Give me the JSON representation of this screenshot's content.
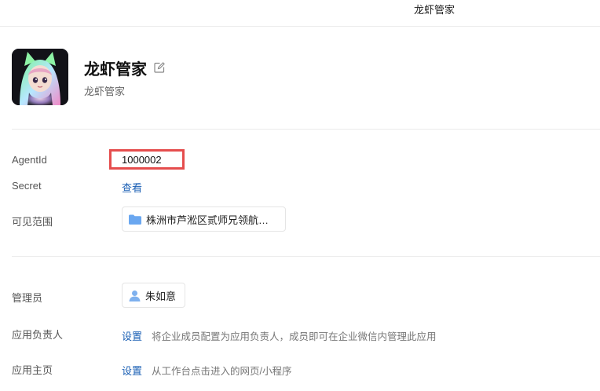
{
  "header": {
    "title": "龙虾管家"
  },
  "app": {
    "name": "龙虾管家",
    "description": "龙虾管家",
    "avatar_icon": "avatar-image",
    "edit_icon": "edit-icon"
  },
  "fields": {
    "agentid": {
      "label": "AgentId",
      "value": "1000002"
    },
    "secret": {
      "label": "Secret",
      "action": "查看"
    },
    "visibility": {
      "label": "可见范围",
      "value": "株洲市芦淞区贰师兄领航…"
    },
    "admin": {
      "label": "管理员",
      "value": "朱如意"
    },
    "owner": {
      "label": "应用负责人",
      "action": "设置",
      "hint": "将企业成员配置为应用负责人，成员即可在企业微信内管理此应用"
    },
    "homepage": {
      "label": "应用主页",
      "action": "设置",
      "hint": "从工作台点击进入的网页/小程序"
    }
  },
  "colors": {
    "link": "#1a5fb4",
    "highlight": "#e54d4d",
    "folder": "#6aa7f0"
  }
}
